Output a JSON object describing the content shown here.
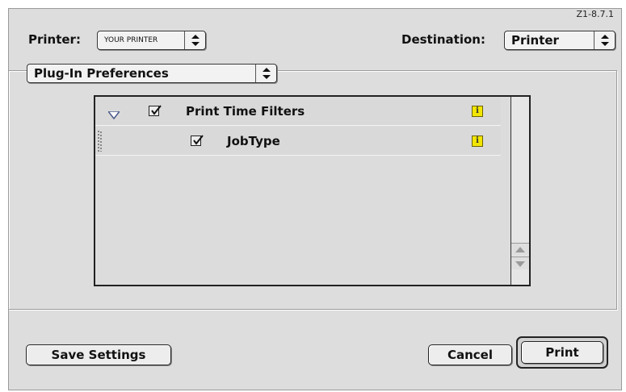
{
  "version": "Z1-8.7.1",
  "printer": {
    "label": "Printer:",
    "value": "YOUR PRINTER"
  },
  "destination": {
    "label": "Destination:",
    "value": "Printer"
  },
  "panel_menu": {
    "value": "Plug-In Preferences"
  },
  "tree": {
    "rows": [
      {
        "label": "Print Time Filters",
        "checked": true,
        "expanded": true,
        "has_info": true
      },
      {
        "label": "JobType",
        "checked": true,
        "has_info": true
      }
    ],
    "info_glyph": "i"
  },
  "buttons": {
    "save": "Save Settings",
    "cancel": "Cancel",
    "print": "Print"
  },
  "icons": {
    "popup_arrows": "up-down-arrows-icon",
    "disclosure": "disclosure-triangle-down-icon",
    "checkbox": "checkmark-icon",
    "info": "info-icon",
    "drag": "drag-handle-icon",
    "scroll_up": "scroll-up-arrow-icon",
    "scroll_down": "scroll-down-arrow-icon"
  },
  "colors": {
    "dialog_bg": "#dddddd",
    "info_badge": "#f2e600",
    "disclosure": "#4a5a8a"
  }
}
